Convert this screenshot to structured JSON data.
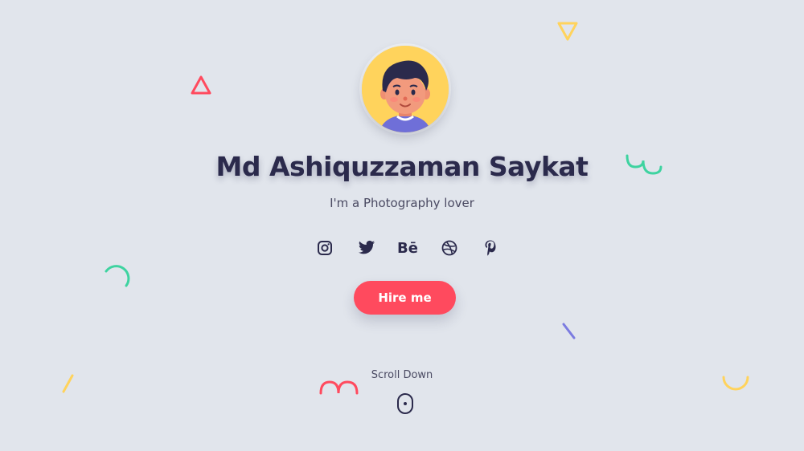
{
  "hero": {
    "name": "Md Ashiquzzaman Saykat",
    "tagline": "I'm a Photography lover",
    "cta_label": "Hire me",
    "scroll_label": "Scroll Down"
  },
  "socials": [
    {
      "icon": "instagram-icon"
    },
    {
      "icon": "twitter-icon"
    },
    {
      "icon": "behance-icon",
      "text": "Bē"
    },
    {
      "icon": "dribbble-icon"
    },
    {
      "icon": "pinterest-icon"
    }
  ],
  "colors": {
    "background": "#e1e5ec",
    "accent": "#ff4a5e",
    "text_dark": "#2b2a4c",
    "avatar_bg": "#ffd35c",
    "teal": "#3ed3a0",
    "yellow": "#ffd35c",
    "purple": "#7b7be0",
    "red": "#ff4a5e"
  }
}
